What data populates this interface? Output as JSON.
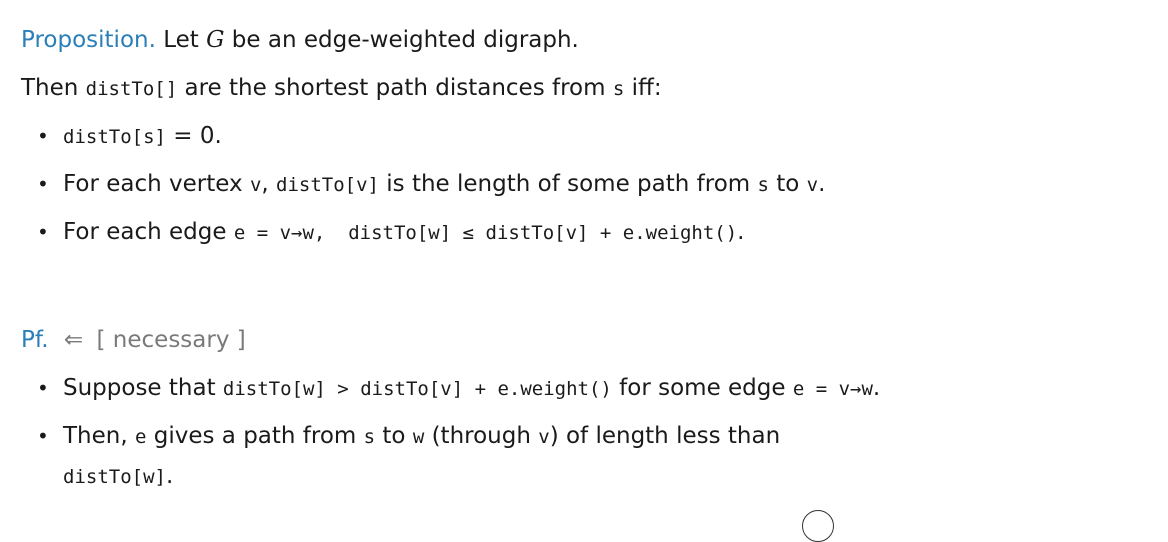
{
  "proposition": {
    "heading": "Proposition.",
    "text_a": "Let ",
    "var_g": "G",
    "text_b": " be an edge-weighted digraph."
  },
  "then_line": {
    "text_a": "Then ",
    "code_a": "distTo[]",
    "text_b": " are the shortest path distances from ",
    "code_s": "s",
    "text_c": " iff:"
  },
  "conditions": {
    "c1": {
      "code": "distTo[s]",
      "text": " = 0."
    },
    "c2": {
      "text_a": "For each vertex ",
      "code_v": "v",
      "text_b": ", ",
      "code_dist": "distTo[v]",
      "text_c": " is the length of some path from ",
      "code_s": "s",
      "text_d": " to ",
      "code_v2": "v",
      "text_e": "."
    },
    "c3": {
      "text_a": "For each edge ",
      "code_edge": "e = v→w,  distTo[w] ≤ distTo[v] + e.weight()",
      "text_b": "."
    }
  },
  "proof": {
    "heading": "Pf.",
    "arrow": "⇐",
    "direction": "[ necessary ]",
    "b1": {
      "text_a": "Suppose that ",
      "code_a": "distTo[w] > distTo[v] + e.weight()",
      "text_b": " for some edge ",
      "code_b": "e = v→w",
      "text_c": "."
    },
    "b2": {
      "text_a": "Then, ",
      "code_e": "e",
      "text_b": " gives a path from ",
      "code_s": "s",
      "text_c": " to ",
      "code_w": "w",
      "text_d": " (through ",
      "code_v": "v",
      "text_e": ") of length less than",
      "code_cont": "distTo[w]",
      "text_f": "."
    }
  },
  "colors": {
    "accent": "#2a7fb8",
    "muted": "#7a7a7a",
    "text": "#1a1a1a"
  }
}
